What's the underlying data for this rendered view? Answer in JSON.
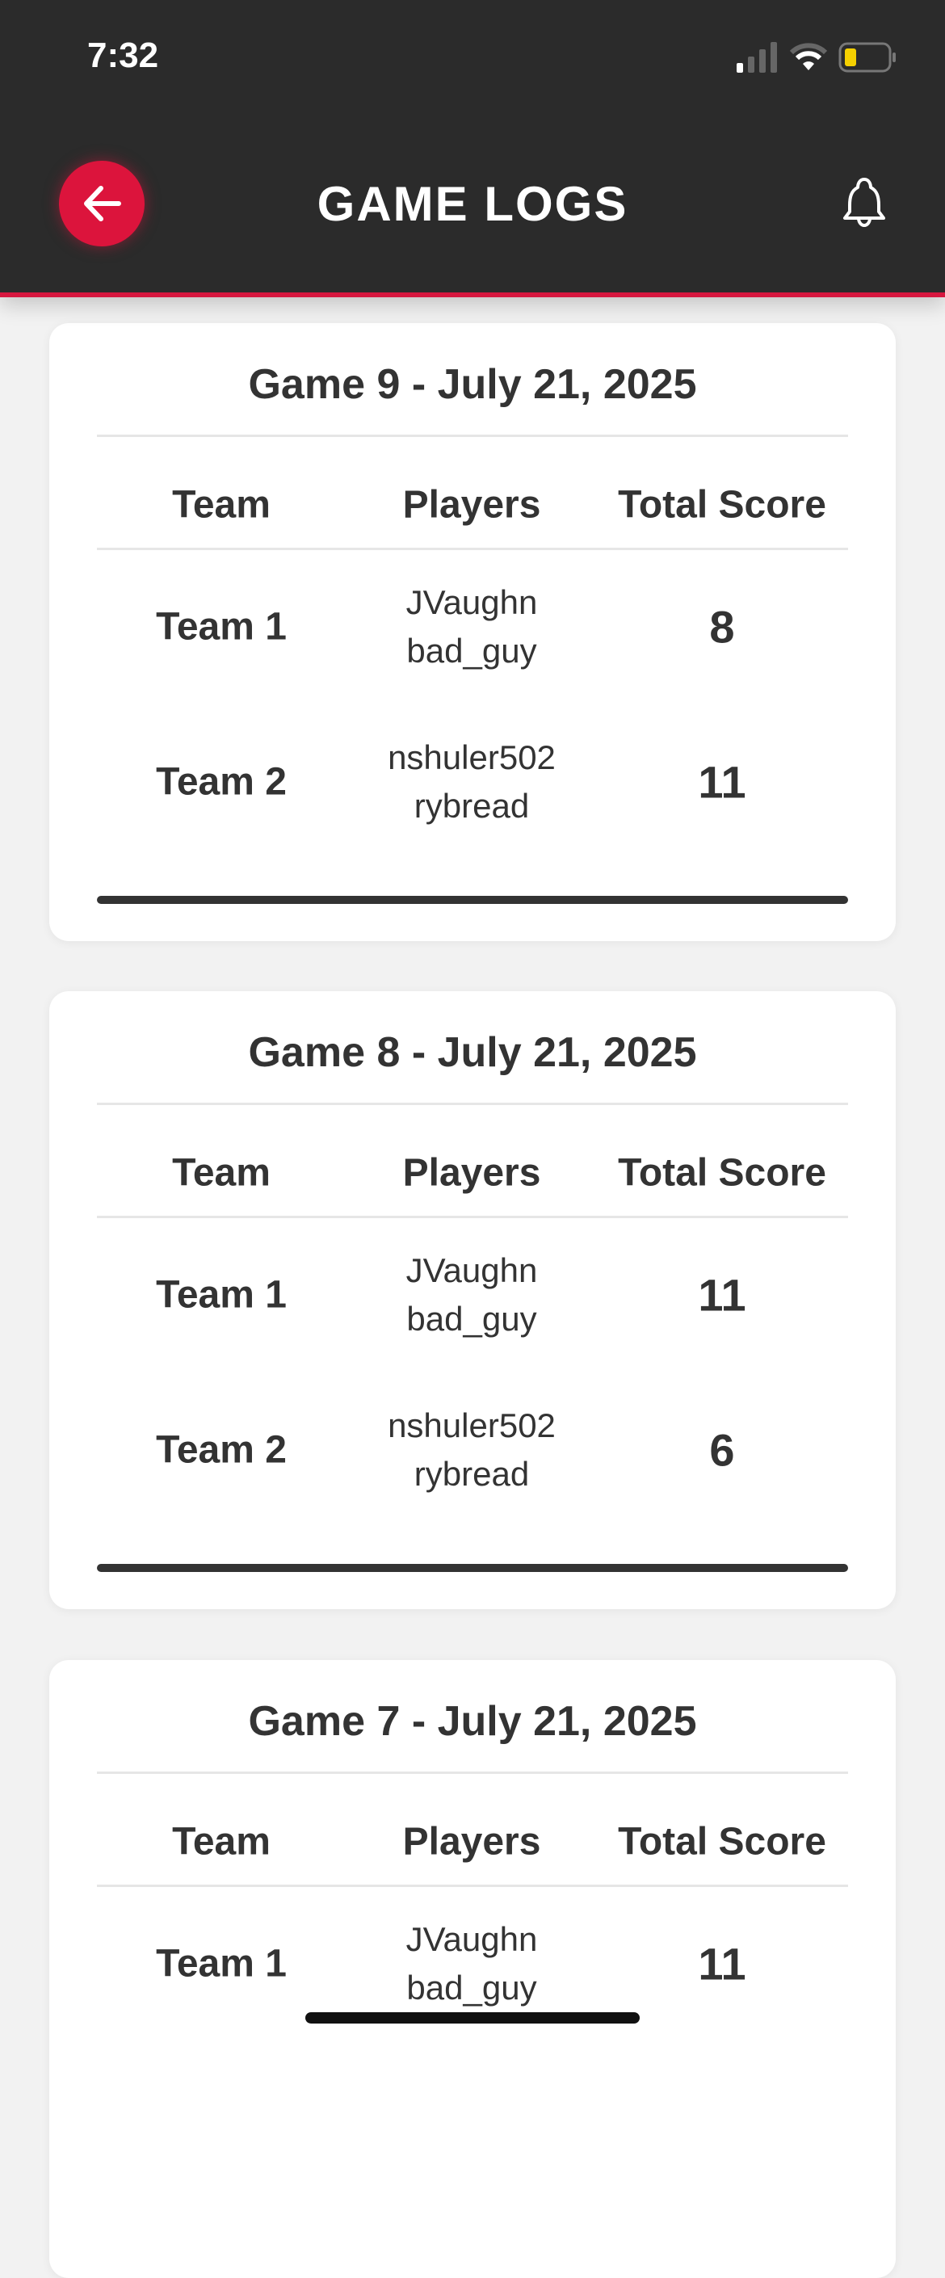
{
  "status_bar": {
    "time": "7:32"
  },
  "header": {
    "title": "GAME LOGS"
  },
  "columns": {
    "team": "Team",
    "players": "Players",
    "score": "Total Score"
  },
  "colors": {
    "accent": "#dc143c",
    "header_bg": "#2b2b2b",
    "battery": "#f5d000"
  },
  "games": [
    {
      "title": "Game 9 - July 21, 2025",
      "teams": [
        {
          "name": "Team 1",
          "players": [
            "JVaughn",
            "bad_guy"
          ],
          "score": "8"
        },
        {
          "name": "Team 2",
          "players": [
            "nshuler502",
            "rybread"
          ],
          "score": "11"
        }
      ]
    },
    {
      "title": "Game 8 - July 21, 2025",
      "teams": [
        {
          "name": "Team 1",
          "players": [
            "JVaughn",
            "bad_guy"
          ],
          "score": "11"
        },
        {
          "name": "Team 2",
          "players": [
            "nshuler502",
            "rybread"
          ],
          "score": "6"
        }
      ]
    },
    {
      "title": "Game 7 - July 21, 2025",
      "teams": [
        {
          "name": "Team 1",
          "players": [
            "JVaughn",
            "bad_guy"
          ],
          "score": "11"
        }
      ]
    }
  ]
}
